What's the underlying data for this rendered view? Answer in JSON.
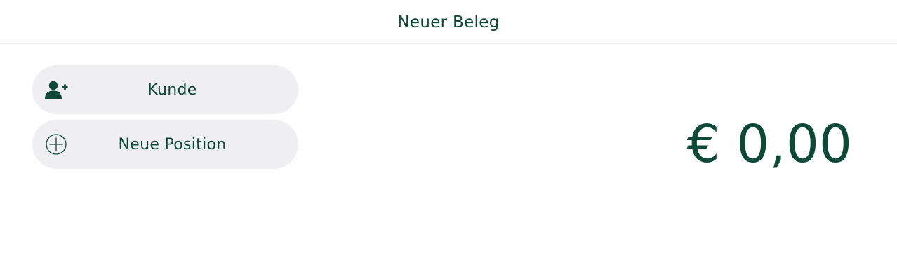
{
  "header": {
    "title": "Neuer Beleg"
  },
  "actions": {
    "customer_label": "Kunde",
    "customer_icon": "add-user-icon",
    "position_label": "Neue Position",
    "position_icon": "plus-circle-icon"
  },
  "total": {
    "amount": "€ 0,00"
  },
  "colors": {
    "primary": "#0c4a37",
    "button_bg": "#efeff1",
    "divider": "#ececec"
  }
}
